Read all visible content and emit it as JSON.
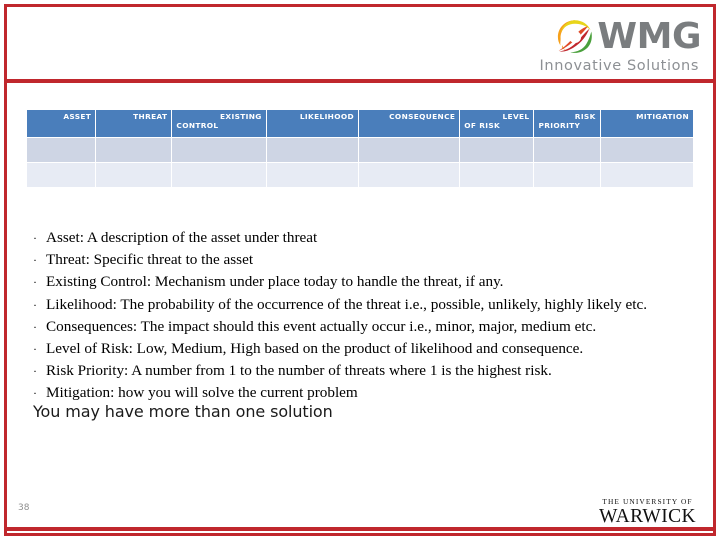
{
  "slide": {
    "page_number": "38",
    "accent_color": "#c0272d",
    "table_header_color": "#4a7ebb",
    "row_a_color": "#ced5e4",
    "row_b_color": "#e7ebf4"
  },
  "header": {
    "logo": {
      "wordmark": "WMG",
      "tagline": "Innovative Solutions",
      "swirl_colors": [
        "#f6a01a",
        "#e8d51a",
        "#c0272d",
        "#e04a28",
        "#4aa03c"
      ]
    }
  },
  "table": {
    "columns": [
      {
        "line1": "ASSET",
        "line2": ""
      },
      {
        "line1": "THREAT",
        "line2": ""
      },
      {
        "line1": "EXISTING",
        "line2": "CONTROL"
      },
      {
        "line1": "LIKELIHOOD",
        "line2": ""
      },
      {
        "line1": "CONSEQUENCE",
        "line2": ""
      },
      {
        "line1": "LEVEL",
        "line2": "OF RISK"
      },
      {
        "line1": "RISK",
        "line2": "PRIORITY"
      },
      {
        "line1": "MITIGATION",
        "line2": ""
      }
    ],
    "rows": [
      [
        "",
        "",
        "",
        "",
        "",
        "",
        "",
        ""
      ],
      [
        "",
        "",
        "",
        "",
        "",
        "",
        "",
        ""
      ]
    ]
  },
  "bullets": [
    "Asset: A description of the asset under threat",
    "Threat: Specific threat to the asset",
    "Existing Control: Mechanism under place today to handle the threat, if any.",
    "Likelihood: The probability of the occurrence of the threat i.e., possible, unlikely, highly likely etc.",
    "Consequences: The impact should this event actually occur i.e., minor, major, medium etc.",
    "Level of Risk: Low, Medium, High based on the product of likelihood and consequence.",
    "Risk Priority: A number from 1 to the number of threats where 1 is the highest risk.",
    "Mitigation: how you will solve the current problem"
  ],
  "bullet_marker": "·",
  "solution_note": "You may have more than one solution",
  "footer": {
    "warwick": {
      "line1": "THE UNIVERSITY OF",
      "line2": "WARWICK"
    }
  }
}
